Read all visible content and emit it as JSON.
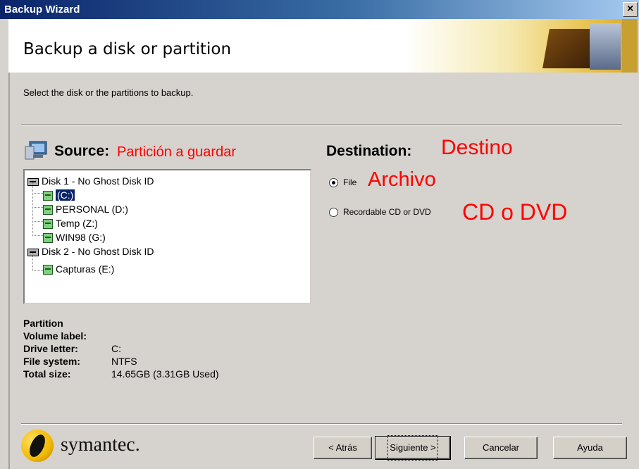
{
  "window": {
    "title": "Backup Wizard",
    "close_label": "×"
  },
  "header": {
    "title": "Backup a disk or partition"
  },
  "instructions": "Select the disk or the partitions to backup.",
  "source": {
    "heading": "Source:",
    "note": "Partición a guardar",
    "tree": [
      {
        "label": "Disk 1 - No Ghost Disk ID",
        "type": "disk"
      },
      {
        "label": "(C:)",
        "type": "partition",
        "selected": true
      },
      {
        "label": "PERSONAL (D:)",
        "type": "partition"
      },
      {
        "label": "Temp (Z:)",
        "type": "partition"
      },
      {
        "label": "WIN98 (G:)",
        "type": "partition"
      },
      {
        "label": "Disk 2 - No Ghost Disk ID",
        "type": "disk"
      },
      {
        "label": "Capturas (E:)",
        "type": "partition"
      }
    ]
  },
  "partition_info": {
    "title": "Partition",
    "rows": [
      {
        "label": "Volume label:",
        "value": ""
      },
      {
        "label": "Drive letter:",
        "value": "C:"
      },
      {
        "label": "File system:",
        "value": "NTFS"
      },
      {
        "label": "Total size:",
        "value": "14.65GB (3.31GB Used)"
      }
    ]
  },
  "destination": {
    "heading": "Destination:",
    "note": "Destino",
    "options": [
      {
        "label": "File",
        "note": "Archivo",
        "selected": true
      },
      {
        "label": "Recordable CD or DVD",
        "note": "CD o DVD",
        "selected": false
      }
    ]
  },
  "logo": {
    "text": "symantec."
  },
  "buttons": {
    "back": "< Atrás",
    "next": "Siguiente >",
    "cancel": "Cancelar",
    "help": "Ayuda"
  },
  "colors": {
    "title_bar": "#0a246a",
    "dialog_bg": "#d6d3ce",
    "annotation_red": "#ff0000",
    "selection": "#0a246a"
  }
}
